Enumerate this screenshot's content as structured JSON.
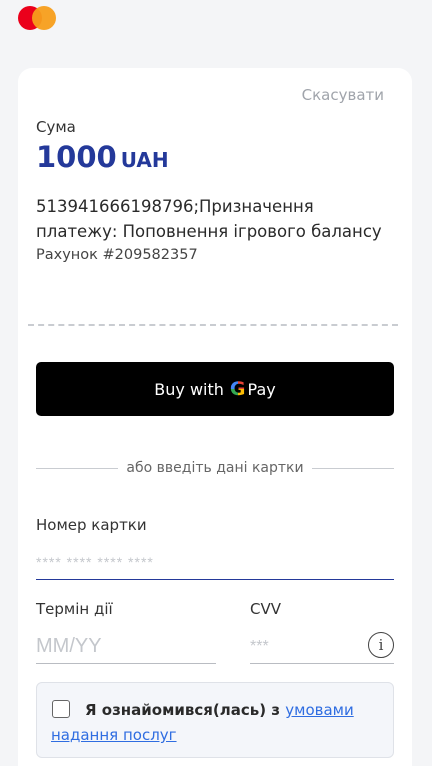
{
  "header": {
    "logo": "mastercard-logo"
  },
  "summary": {
    "cancel_label": "Скасувати",
    "sum_label": "Сума",
    "amount": "1000",
    "currency": "UAH",
    "purpose": "513941666198796;Призначення платежу: Поповнення ігрового балансу",
    "invoice": "Рахунок #209582357"
  },
  "payment": {
    "gpay_prefix": "Buy with",
    "gpay_g": "G",
    "gpay_suffix": "Pay",
    "or_text": "або введіть дані картки"
  },
  "card": {
    "number_label": "Номер картки",
    "number_placeholder": "**** **** **** ****",
    "number_value": "",
    "term_label": "Термін дії",
    "term_placeholder": "MM/YY",
    "cvv_label": "CVV",
    "cvv_placeholder": "***",
    "info_icon": "i"
  },
  "terms": {
    "text": "Я ознайомився(лась) з ",
    "link": "умовами надання послуг",
    "checked": false
  },
  "colors": {
    "accent": "#24399a",
    "link": "#2f6de1",
    "muted": "#a0a4ab"
  }
}
